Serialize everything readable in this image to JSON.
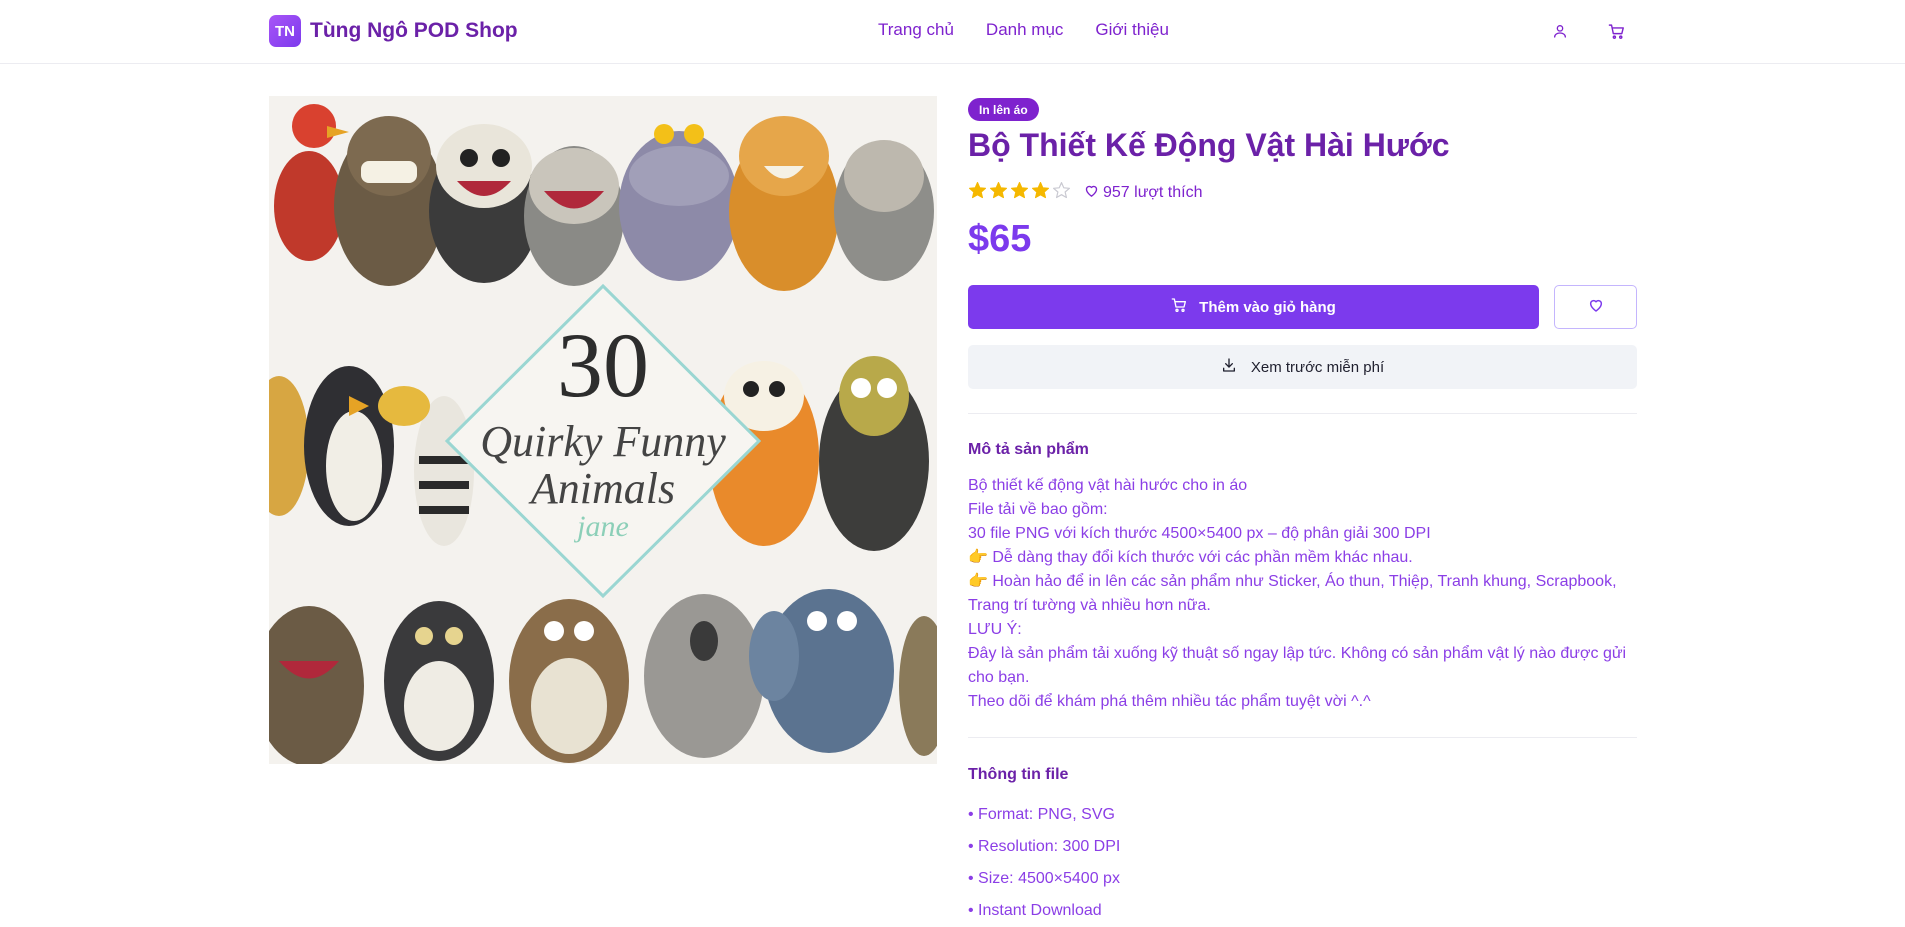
{
  "header": {
    "logo_initials": "TN",
    "shop_name": "Tùng Ngô POD Shop",
    "nav": [
      {
        "label": "Trang chủ"
      },
      {
        "label": "Danh mục"
      },
      {
        "label": "Giới thiệu"
      }
    ]
  },
  "product": {
    "image": {
      "number": "30",
      "line1": "Quirky Funny",
      "line2": "Animals",
      "signature": "jane"
    },
    "badge": "In lên áo",
    "title": "Bộ Thiết Kế Động Vật Hài Hước",
    "rating": 4,
    "rating_max": 5,
    "likes": "957 lượt thích",
    "price": "$65",
    "add_to_cart": "Thêm vào giỏ hàng",
    "preview": "Xem trước miễn phí"
  },
  "description": {
    "title": "Mô tả sản phẩm",
    "lines": [
      "Bộ thiết kế động vật hài hước cho in áo",
      "File tải về bao gồm:",
      "30 file PNG với kích thước 4500×5400 px – độ phân giải 300 DPI",
      "👉 Dễ dàng thay đổi kích thước với các phần mềm khác nhau.",
      "👉 Hoàn hảo để in lên các sản phẩm như Sticker, Áo thun, Thiệp, Tranh khung, Scrapbook, Trang trí tường và nhiều hơn nữa.",
      "LƯU Ý:",
      "Đây là sản phẩm tải xuống kỹ thuật số ngay lập tức. Không có sản phẩm vật lý nào được gửi cho bạn.",
      "Theo dõi để khám phá thêm nhiều tác phẩm tuyệt vời ^.^"
    ]
  },
  "file_info": {
    "title": "Thông tin file",
    "items": [
      "• Format: PNG, SVG",
      "• Resolution: 300 DPI",
      "• Size: 4500×5400 px",
      "• Instant Download"
    ]
  },
  "colors": {
    "primary": "#7c3aed",
    "heading": "#6b21a8",
    "text": "#8b3ee6",
    "star": "#f5b800"
  }
}
